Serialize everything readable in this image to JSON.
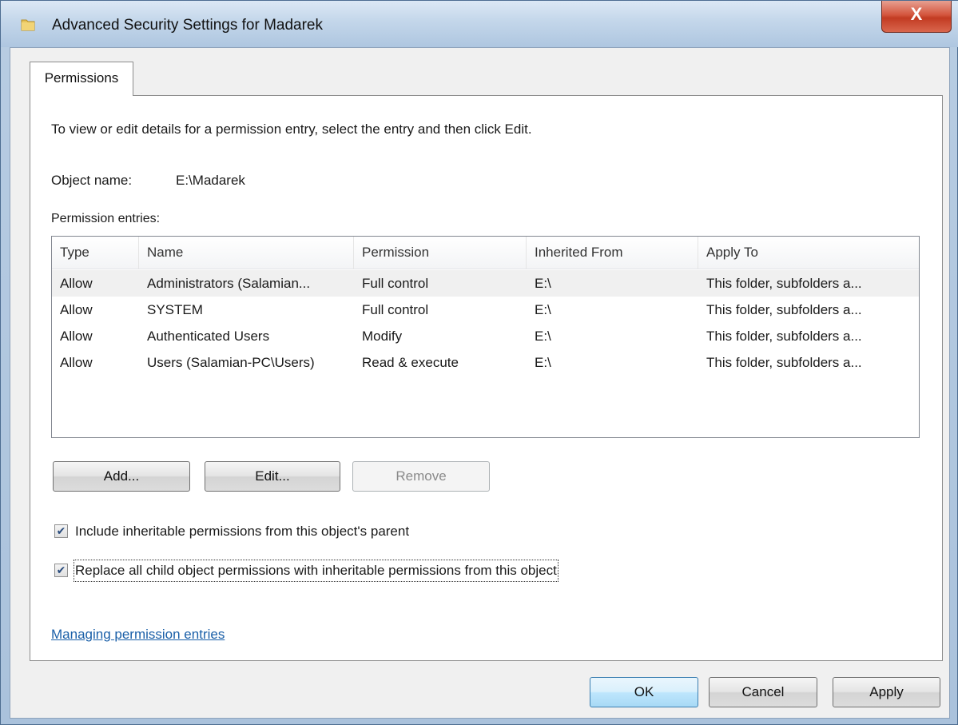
{
  "window": {
    "title": "Advanced Security Settings for Madarek",
    "close_glyph": "X"
  },
  "tabs": [
    {
      "label": "Permissions",
      "active": true
    }
  ],
  "permissions": {
    "instructions": "To view or edit details for a permission entry, select the entry and then click Edit.",
    "object_name_label": "Object name:",
    "object_name_value": "E:\\Madarek",
    "entries_label": "Permission entries:",
    "columns": [
      "Type",
      "Name",
      "Permission",
      "Inherited From",
      "Apply To"
    ],
    "rows": [
      {
        "type": "Allow",
        "name": "Administrators (Salamian...",
        "permission": "Full control",
        "inherited_from": "E:\\",
        "apply_to": "This folder, subfolders a..."
      },
      {
        "type": "Allow",
        "name": "SYSTEM",
        "permission": "Full control",
        "inherited_from": "E:\\",
        "apply_to": "This folder, subfolders a..."
      },
      {
        "type": "Allow",
        "name": "Authenticated Users",
        "permission": "Modify",
        "inherited_from": "E:\\",
        "apply_to": "This folder, subfolders a..."
      },
      {
        "type": "Allow",
        "name": "Users (Salamian-PC\\Users)",
        "permission": "Read & execute",
        "inherited_from": "E:\\",
        "apply_to": "This folder, subfolders a..."
      }
    ],
    "add_label": "Add...",
    "edit_label": "Edit...",
    "remove_label": "Remove",
    "include_inheritable_label": "Include inheritable permissions from this object's parent",
    "include_inheritable_checked": true,
    "replace_child_label": "Replace all child object permissions with inheritable permissions from this object",
    "replace_child_checked": true,
    "help_link": "Managing permission entries"
  },
  "footer": {
    "ok_label": "OK",
    "cancel_label": "Cancel",
    "apply_label": "Apply"
  },
  "icons": {
    "folder": "folder-icon",
    "checkmark": "✔"
  }
}
